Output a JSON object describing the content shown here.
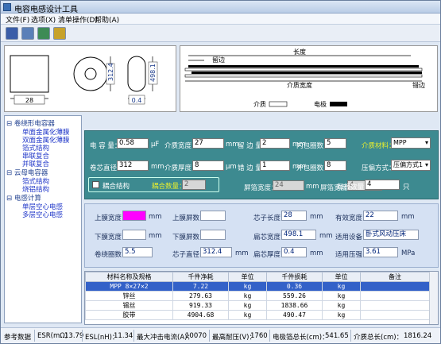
{
  "window": {
    "title": "电容电感设计工具"
  },
  "menu": [
    "文件(F)",
    "选项(X)",
    "清单操作(D)",
    "帮助(A)"
  ],
  "toolbar": [
    "save-icon",
    "table-icon",
    "export-icon",
    "paint-icon"
  ],
  "drawing_left": {
    "width_label": "28",
    "height_label": "312.4",
    "core_label": "498.1",
    "thick_label": "0.4"
  },
  "drawing_right": {
    "length_label": "长度",
    "edge_label": "留边",
    "dielectric_width_label": "介质宽度",
    "offset_label": "错边",
    "legend_dielectric": "介质",
    "legend_electrode": "电极"
  },
  "tree": [
    {
      "label": "卷绕形电容器",
      "level": 1
    },
    {
      "label": "单面金属化薄膜",
      "level": 2
    },
    {
      "label": "双面金属化薄膜",
      "level": 2
    },
    {
      "label": "箔式结构",
      "level": 2
    },
    {
      "label": "串联复合",
      "level": 2
    },
    {
      "label": "并联复合",
      "level": 2
    },
    {
      "label": "云母电容器",
      "level": 1
    },
    {
      "label": "箔式结构",
      "level": 2
    },
    {
      "label": "烧铝结构",
      "level": 2
    },
    {
      "label": "电感计算",
      "level": 1
    },
    {
      "label": "单层空心电感",
      "level": 2
    },
    {
      "label": "多层空心电感",
      "level": 2
    }
  ],
  "params": {
    "capacitance_label": "电 容 量：",
    "capacitance": "0.58",
    "capacitance_unit": "μF",
    "dielectric_width_label": "介质宽度：",
    "dielectric_width": "27",
    "dielectric_width_unit": "mm",
    "edge_label": "留 边 量：",
    "edge": "2",
    "edge_unit": "mm",
    "inner_turns_label": "内包圈数：",
    "inner_turns": "5",
    "material_label": "介质材料：",
    "material": "MPP",
    "core_dia_label": "卷芯直径：",
    "core_dia": "312",
    "core_dia_unit": "mm",
    "dielectric_thick_label": "介质厚度：",
    "dielectric_thick": "8",
    "dielectric_thick_unit": "μm",
    "offset_label": "错 边 量：",
    "offset": "1",
    "offset_unit": "mm",
    "outer_turns_label": "外包圈数：",
    "outer_turns": "8",
    "press_label": "压偏方式：",
    "press": "压偏方式1",
    "coupling_label": "耦合结构",
    "coupling_count_label": "耦合数量：",
    "coupling_count": "2",
    "foil_width_label": "屏箔宽度：",
    "foil_width": "24",
    "foil_width_unit": "mm",
    "foil_thick_label": "屏箔宽度：",
    "foil_thick": "4",
    "foil_thick_unit": "mm",
    "layers_label": "每板数量：",
    "layers": "4",
    "layers_unit": "只"
  },
  "outputs": {
    "top_shield_width_label": "上膜宽度：",
    "top_shield_width_unit": "mm",
    "top_shield_turns_label": "上膜屏数：",
    "core_length_label": "芯子长度：",
    "core_length": "28",
    "core_length_unit": "mm",
    "effective_width_label": "有效宽度：",
    "effective_width": "22",
    "effective_width_unit": "mm",
    "bottom_shield_width_label": "下膜宽度：",
    "bottom_shield_width_unit": "mm",
    "bottom_shield_turns_label": "下膜屏数：",
    "flat_width_label": "扁芯宽度：",
    "flat_width": "498.1",
    "flat_width_unit": "mm",
    "equipment_label": "适用设备：",
    "equipment": "卧式风动压床",
    "winding_turns_label": "卷绕圈数：",
    "winding_turns": "5.5",
    "core_dia_label": "芯子直径：",
    "core_dia": "312.4",
    "core_dia_unit": "mm",
    "flat_thick_label": "扁芯厚度：",
    "flat_thick": "0.4",
    "flat_thick_unit": "mm",
    "pressure_label": "适用压强：",
    "pressure": "3.61",
    "pressure_unit": "MPa"
  },
  "table": {
    "headers": [
      "材料名称及规格",
      "千件净耗",
      "单位",
      "千件损耗",
      "单位",
      "备注"
    ],
    "rows": [
      [
        "MPP 8×27×2",
        "7.22",
        "kg",
        "0.36",
        "kg",
        ""
      ],
      [
        "锌丝",
        "279.63",
        "kg",
        "559.26",
        "kg",
        ""
      ],
      [
        "锡丝",
        "919.33",
        "kg",
        "1838.66",
        "kg",
        ""
      ],
      [
        "胶带",
        "4904.68",
        "kg",
        "490.47",
        "kg",
        ""
      ]
    ]
  },
  "status": {
    "ref_label": "参考数据",
    "esr_label": "ESR(mΩ)",
    "esr": "13.79",
    "esl_label": "ESL(nH)：",
    "esl": "11.34",
    "surge_label": "最大冲击电流(A)：",
    "surge": "10070",
    "voltage_label": "最高耐压(V)：",
    "voltage": "1760",
    "electrode_len_label": "电极箔总长(cm)：",
    "electrode_len": "541.65",
    "dielectric_len_label": "介质总长(cm)：",
    "dielectric_len": "1816.24"
  },
  "colors": {
    "params_bg": "#3d8a90",
    "highlight": "#ff00ff",
    "accent": "#e8ef2e"
  }
}
